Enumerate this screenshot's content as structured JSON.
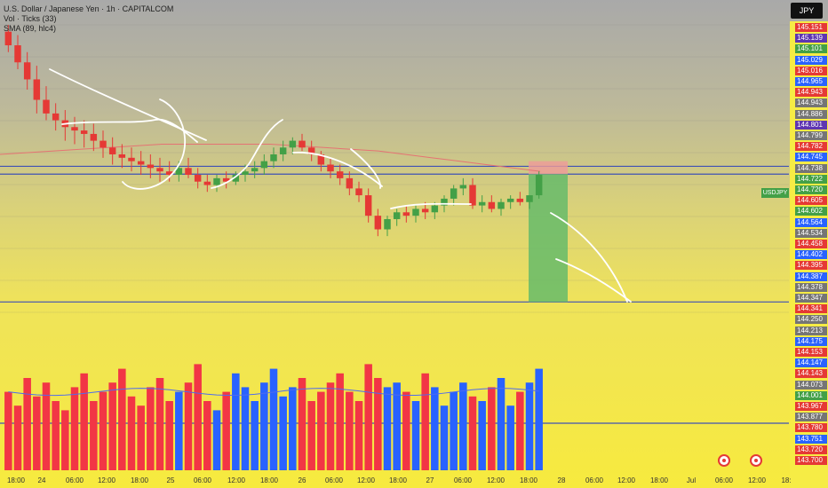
{
  "legend": {
    "title": "U.S. Dollar / Japanese Yen · 1h · CAPITALCOM",
    "volume": "Vol · Ticks (33)",
    "sma": "SMA (89, hlc4)"
  },
  "currency_badge": "JPY",
  "symbol_label": "USDJPY",
  "colors": {
    "up": "#43a047",
    "down": "#e53935",
    "vol_up": "#2962ff",
    "vol_down": "#f23645",
    "sma": "#e57373",
    "hline": "#3f51b5",
    "box_green": "#66bb6a",
    "box_red": "#ef9a9a"
  },
  "price_labels": [
    {
      "v": "145.151",
      "c": "#e53935"
    },
    {
      "v": "145.139",
      "c": "#5e35b1"
    },
    {
      "v": "145.101",
      "c": "#43a047"
    },
    {
      "v": "145.029",
      "c": "#2962ff"
    },
    {
      "v": "145.016",
      "c": "#e53935"
    },
    {
      "v": "144.965",
      "c": "#2962ff"
    },
    {
      "v": "144.943",
      "c": "#e53935"
    },
    {
      "v": "144.943",
      "c": "#757575"
    },
    {
      "v": "144.886",
      "c": "#757575"
    },
    {
      "v": "144.801",
      "c": "#5e35b1"
    },
    {
      "v": "144.799",
      "c": "#757575"
    },
    {
      "v": "144.782",
      "c": "#e53935"
    },
    {
      "v": "144.745",
      "c": "#2962ff"
    },
    {
      "v": "144.738",
      "c": "#757575"
    },
    {
      "v": "144.722",
      "c": "#43a047"
    },
    {
      "v": "144.720",
      "c": "#43a047"
    },
    {
      "v": "144.605",
      "c": "#e53935"
    },
    {
      "v": "144.602",
      "c": "#43a047"
    },
    {
      "v": "144.564",
      "c": "#2962ff"
    },
    {
      "v": "144.534",
      "c": "#757575"
    },
    {
      "v": "144.458",
      "c": "#e53935"
    },
    {
      "v": "144.402",
      "c": "#2962ff"
    },
    {
      "v": "144.395",
      "c": "#e53935"
    },
    {
      "v": "144.387",
      "c": "#2962ff"
    },
    {
      "v": "144.378",
      "c": "#757575"
    },
    {
      "v": "144.347",
      "c": "#757575"
    },
    {
      "v": "144.341",
      "c": "#e53935"
    },
    {
      "v": "144.250",
      "c": "#757575"
    },
    {
      "v": "144.213",
      "c": "#757575"
    },
    {
      "v": "144.175",
      "c": "#2962ff"
    },
    {
      "v": "144.153",
      "c": "#e53935"
    },
    {
      "v": "144.147",
      "c": "#2962ff"
    },
    {
      "v": "144.143",
      "c": "#e53935"
    },
    {
      "v": "144.073",
      "c": "#757575"
    },
    {
      "v": "144.001",
      "c": "#43a047"
    },
    {
      "v": "143.967",
      "c": "#e53935"
    },
    {
      "v": "143.877",
      "c": "#757575"
    },
    {
      "v": "143.780",
      "c": "#e53935"
    },
    {
      "v": "143.751",
      "c": "#2962ff"
    },
    {
      "v": "143.720",
      "c": "#e53935"
    },
    {
      "v": "143.700",
      "c": "#e53935"
    }
  ],
  "time_labels": [
    "18:00",
    "24",
    "06:00",
    "12:00",
    "18:00",
    "25",
    "06:00",
    "12:00",
    "18:00",
    "26",
    "06:00",
    "12:00",
    "18:00",
    "27",
    "06:00",
    "12:00",
    "18:00",
    "28",
    "06:00",
    "12:00",
    "18:00",
    "Jul",
    "06:00",
    "12:00",
    "18:"
  ],
  "chart_data": {
    "type": "candlestick",
    "symbol": "USDJPY",
    "interval": "1h",
    "price_range": [
      143.7,
      145.16
    ],
    "candles_ohlc": [
      [
        145.14,
        145.16,
        145.08,
        145.1
      ],
      [
        145.1,
        145.13,
        145.03,
        145.05
      ],
      [
        145.05,
        145.08,
        144.97,
        145.0
      ],
      [
        145.0,
        145.04,
        144.9,
        144.94
      ],
      [
        144.94,
        144.98,
        144.88,
        144.9
      ],
      [
        144.9,
        144.93,
        144.85,
        144.88
      ],
      [
        144.88,
        144.91,
        144.82,
        144.86
      ],
      [
        144.86,
        144.89,
        144.81,
        144.85
      ],
      [
        144.85,
        144.88,
        144.8,
        144.84
      ],
      [
        144.84,
        144.87,
        144.79,
        144.82
      ],
      [
        144.82,
        144.85,
        144.77,
        144.8
      ],
      [
        144.8,
        144.83,
        144.75,
        144.78
      ],
      [
        144.78,
        144.81,
        144.74,
        144.77
      ],
      [
        144.77,
        144.8,
        144.73,
        144.76
      ],
      [
        144.76,
        144.79,
        144.72,
        144.75
      ],
      [
        144.75,
        144.78,
        144.71,
        144.74
      ],
      [
        144.74,
        144.77,
        144.7,
        144.73
      ],
      [
        144.73,
        144.76,
        144.7,
        144.72
      ],
      [
        144.72,
        144.76,
        144.7,
        144.74
      ],
      [
        144.74,
        144.77,
        144.71,
        144.72
      ],
      [
        144.72,
        144.74,
        144.68,
        144.7
      ],
      [
        144.7,
        144.72,
        144.67,
        144.69
      ],
      [
        144.69,
        144.72,
        144.67,
        144.71
      ],
      [
        144.71,
        144.73,
        144.68,
        144.7
      ],
      [
        144.7,
        144.73,
        144.69,
        144.72
      ],
      [
        144.72,
        144.75,
        144.7,
        144.73
      ],
      [
        144.73,
        144.76,
        144.71,
        144.74
      ],
      [
        144.74,
        144.78,
        144.72,
        144.76
      ],
      [
        144.76,
        144.8,
        144.74,
        144.78
      ],
      [
        144.78,
        144.82,
        144.76,
        144.8
      ],
      [
        144.8,
        144.83,
        144.78,
        144.82
      ],
      [
        144.82,
        144.84,
        144.79,
        144.8
      ],
      [
        144.8,
        144.82,
        144.76,
        144.78
      ],
      [
        144.78,
        144.79,
        144.73,
        144.75
      ],
      [
        144.75,
        144.77,
        144.71,
        144.73
      ],
      [
        144.73,
        144.75,
        144.69,
        144.71
      ],
      [
        144.71,
        144.73,
        144.66,
        144.68
      ],
      [
        144.68,
        144.7,
        144.64,
        144.66
      ],
      [
        144.66,
        144.68,
        144.58,
        144.6
      ],
      [
        144.6,
        144.62,
        144.54,
        144.56
      ],
      [
        144.56,
        144.6,
        144.54,
        144.59
      ],
      [
        144.59,
        144.62,
        144.57,
        144.61
      ],
      [
        144.61,
        144.63,
        144.58,
        144.6
      ],
      [
        144.6,
        144.63,
        144.58,
        144.62
      ],
      [
        144.62,
        144.64,
        144.59,
        144.61
      ],
      [
        144.61,
        144.64,
        144.59,
        144.63
      ],
      [
        144.63,
        144.66,
        144.61,
        144.65
      ],
      [
        144.65,
        144.69,
        144.63,
        144.68
      ],
      [
        144.68,
        144.71,
        144.66,
        144.69
      ],
      [
        144.69,
        144.71,
        144.62,
        144.63
      ],
      [
        144.63,
        144.66,
        144.61,
        144.64
      ],
      [
        144.64,
        144.66,
        144.61,
        144.62
      ],
      [
        144.62,
        144.65,
        144.6,
        144.64
      ],
      [
        144.64,
        144.66,
        144.62,
        144.65
      ],
      [
        144.65,
        144.67,
        144.63,
        144.64
      ],
      [
        144.64,
        144.66,
        144.62,
        144.66
      ],
      [
        144.66,
        144.73,
        144.65,
        144.72
      ]
    ],
    "sma": {
      "name": "SMA (89, hlc4)",
      "values": [
        144.78,
        144.79,
        144.8,
        144.81,
        144.81,
        144.81,
        144.8,
        144.79,
        144.77,
        144.75,
        144.73
      ]
    },
    "horizontal_lines": [
      144.745,
      144.722,
      144.347,
      143.877
    ],
    "volume": [
      34,
      28,
      40,
      32,
      38,
      30,
      26,
      36,
      42,
      30,
      34,
      38,
      44,
      32,
      28,
      36,
      40,
      30,
      34,
      38,
      46,
      30,
      26,
      34,
      42,
      36,
      30,
      38,
      44,
      32,
      36,
      40,
      30,
      34,
      38,
      42,
      34,
      30,
      46,
      40,
      36,
      38,
      34,
      30,
      42,
      36,
      28,
      34,
      38,
      32,
      30,
      36,
      40,
      28,
      34,
      38,
      44
    ],
    "y_axis_ticks_from_labels": true
  }
}
